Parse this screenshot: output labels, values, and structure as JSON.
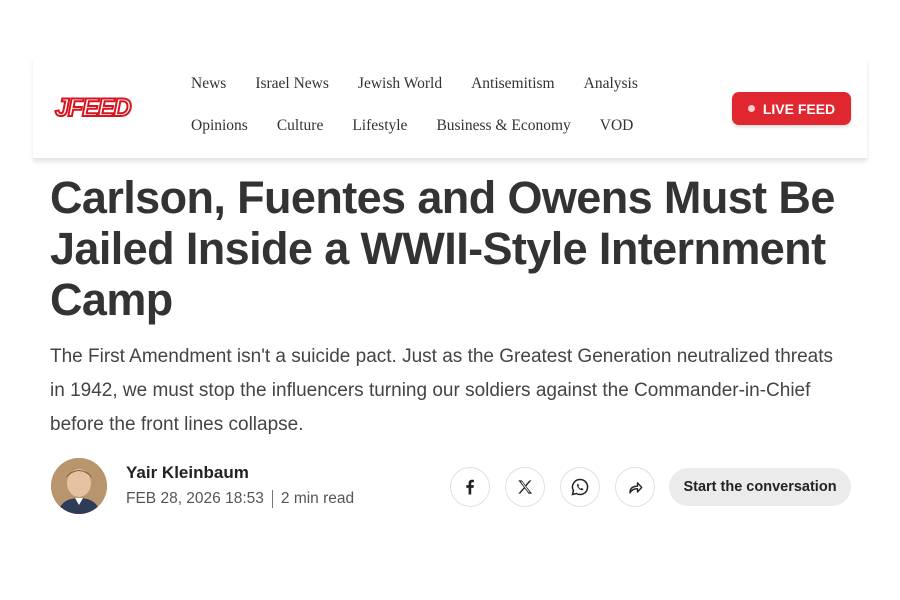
{
  "brand": {
    "logo_text": "JFEED",
    "accent": "#e0262e"
  },
  "nav": {
    "row1": [
      "News",
      "Israel News",
      "Jewish World",
      "Antisemitism",
      "Analysis"
    ],
    "row2": [
      "Opinions",
      "Culture",
      "Lifestyle",
      "Business & Economy",
      "VOD"
    ]
  },
  "live_feed": {
    "label": "LIVE FEED"
  },
  "article": {
    "headline": "Carlson, Fuentes and Owens Must Be Jailed Inside a WWII-Style Internment Camp",
    "subheadline": "The First Amendment isn't a suicide pact. Just as the Greatest Generation neutralized threats in 1942, we must stop the influencers turning our soldiers against the Commander-in-Chief before the front lines collapse.",
    "author": "Yair Kleinbaum",
    "date": "FEB 28, 2026 18:53",
    "read_time": "2 min read"
  },
  "share": {
    "icons": [
      "facebook-icon",
      "x-icon",
      "whatsapp-icon",
      "share-arrow-icon"
    ],
    "conversation_label": "Start the conversation"
  }
}
